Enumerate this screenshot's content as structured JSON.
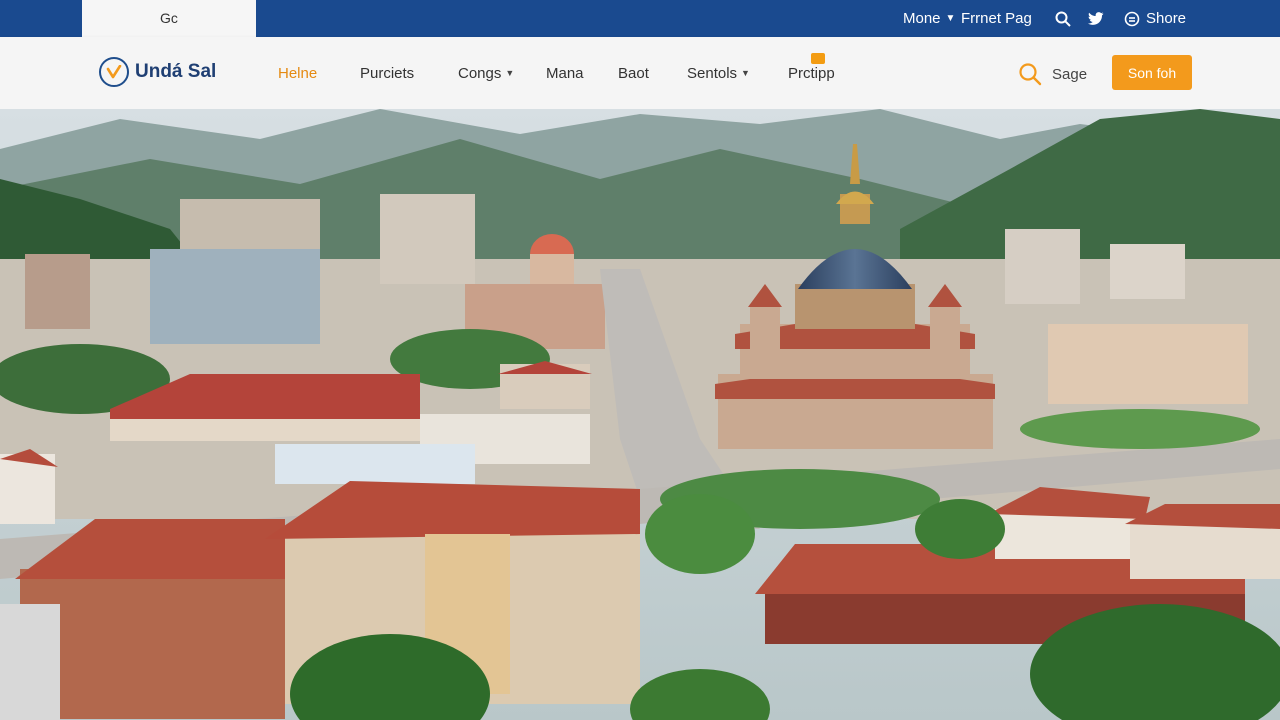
{
  "topbar": {
    "tab_label": "Gc",
    "links": [
      {
        "label": "Mone"
      },
      {
        "label": "Frrnet Pag"
      }
    ],
    "share_label": "Shore"
  },
  "nav": {
    "brand": "Undá Sal",
    "links": [
      {
        "label": "Helne"
      },
      {
        "label": "Purciets"
      },
      {
        "label": "Congs"
      },
      {
        "label": "Mana"
      },
      {
        "label": "Baot"
      },
      {
        "label": "Sentols"
      },
      {
        "label": "Prctipp"
      }
    ],
    "search_label": "Sage",
    "cta_label": "Son foh"
  },
  "colors": {
    "topbar": "#1a4a8f",
    "accent": "#f39a1c",
    "brand": "#1f3f73"
  },
  "icons": [
    "search-icon",
    "twitter-bird-icon",
    "share-circle-icon",
    "chevron-down-icon",
    "logo-check-icon"
  ]
}
